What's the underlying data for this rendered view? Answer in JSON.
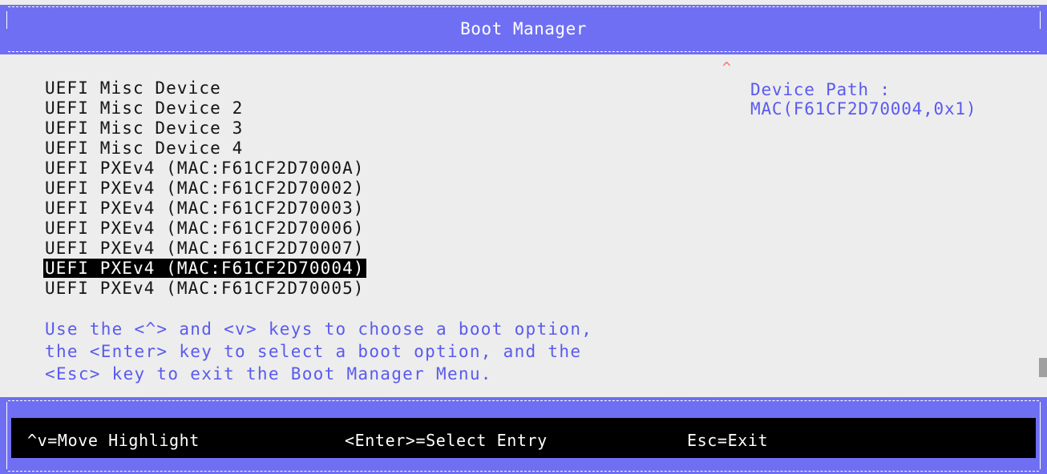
{
  "header": {
    "title": "Boot Manager"
  },
  "scroll_indicator": "^",
  "boot_options": [
    "UEFI Misc Device",
    "UEFI Misc Device 2",
    "UEFI Misc Device 3",
    "UEFI Misc Device 4",
    "UEFI PXEv4 (MAC:F61CF2D7000A)",
    "UEFI PXEv4 (MAC:F61CF2D70002)",
    "UEFI PXEv4 (MAC:F61CF2D70003)",
    "UEFI PXEv4 (MAC:F61CF2D70006)",
    "UEFI PXEv4 (MAC:F61CF2D70007)",
    "UEFI PXEv4 (MAC:F61CF2D70004)",
    "UEFI PXEv4 (MAC:F61CF2D70005)"
  ],
  "selected_index": 9,
  "help_text": [
    "Use the <^> and <v> keys to choose a boot option,",
    "the <Enter> key to select a boot option, and the",
    "<Esc> key to exit the Boot Manager Menu."
  ],
  "device_path": {
    "label": "Device Path :",
    "value": "MAC(F61CF2D70004,0x1)"
  },
  "footer": {
    "move": "^v=Move Highlight",
    "select": "<Enter>=Select Entry",
    "exit": "Esc=Exit"
  },
  "colors": {
    "frame": "#6f6ff3",
    "background": "#ededed",
    "help_text": "#5a5af0",
    "highlight_bg": "#000000",
    "scroll_indicator": "#ff6666"
  }
}
